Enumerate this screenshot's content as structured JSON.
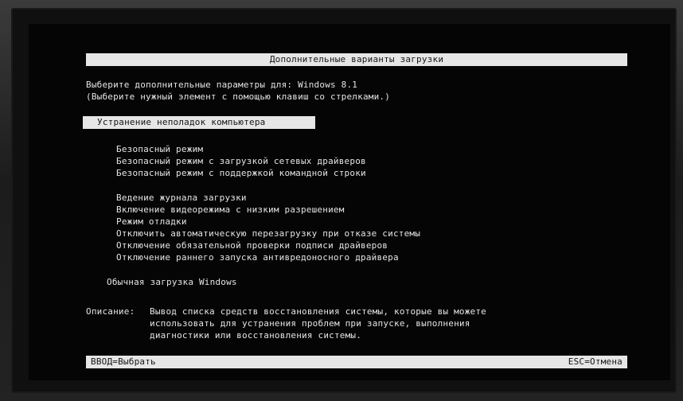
{
  "title": "Дополнительные варианты загрузки",
  "header": {
    "line1": "Выберите дополнительные параметры для: Windows 8.1",
    "line2": "(Выберите нужный элемент с помощью клавиш со стрелками.)"
  },
  "selected_item": "Устранение неполадок компьютера",
  "group1": [
    "Безопасный режим",
    "Безопасный режим с загрузкой сетевых драйверов",
    "Безопасный режим с поддержкой командной строки"
  ],
  "group2": [
    "Ведение журнала загрузки",
    "Включение видеорежима с низким разрешением",
    "Режим отладки",
    "Отключить автоматическую перезагрузку при отказе системы",
    "Отключение обязательной проверки подписи драйверов",
    "Отключение раннего запуска антивредоносного драйвера"
  ],
  "normal_boot": "Обычная загрузка Windows",
  "description": {
    "label": "Описание:",
    "lines": [
      "Вывод списка средств восстановления системы, которые вы можете",
      "использовать для устранения проблем при запуске, выполнения",
      "диагностики или восстановления системы."
    ]
  },
  "footer": {
    "enter": "ВВОД=Выбрать",
    "esc": "ESC=Отмена"
  },
  "colors": {
    "screen_bg": "#050505",
    "text": "#e4e4e4",
    "bar_bg": "#e6e6e6",
    "bar_text": "#151515"
  }
}
